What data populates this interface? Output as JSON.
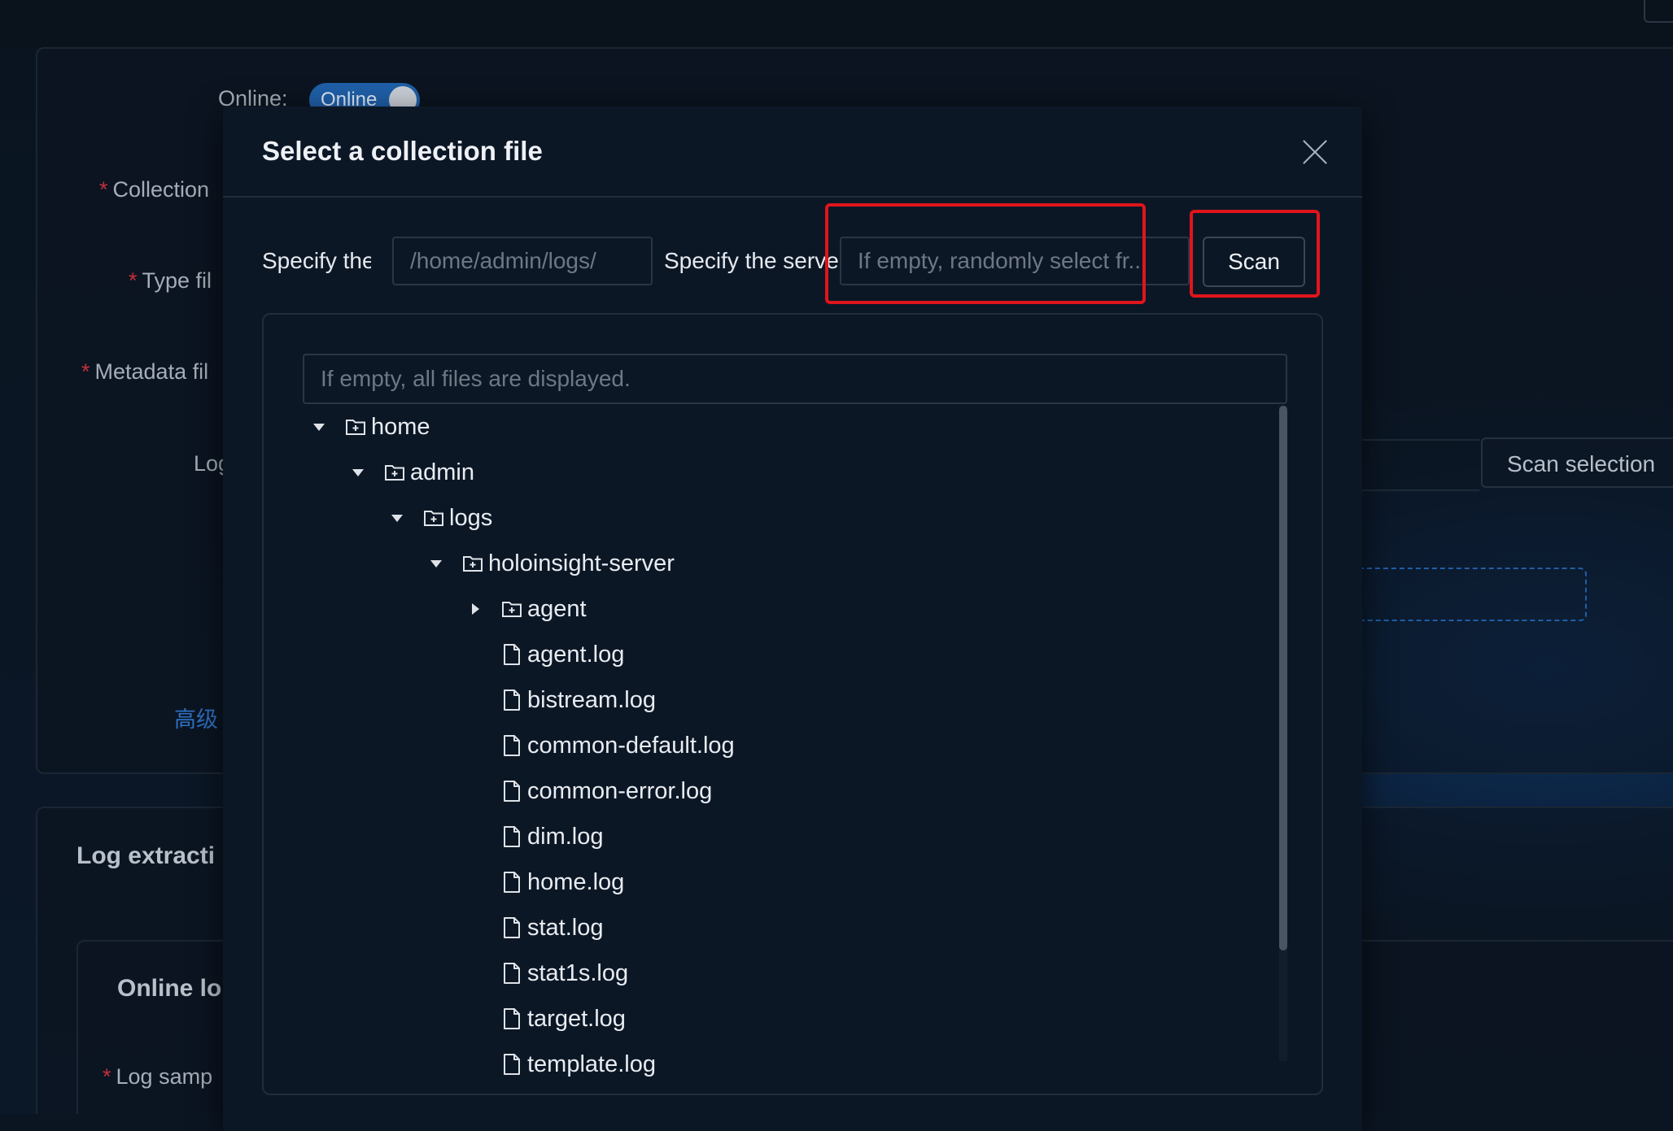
{
  "background": {
    "online_label": "Online:",
    "online_toggle_text": "Online",
    "collection_label": "Collection",
    "type_label": "Type fil",
    "metadata_label": "Metadata fil",
    "log_label": "Log",
    "advanced_link": "高级",
    "section_title": "Log extracti",
    "subsection_title": "Online lo",
    "log_sample_label": "Log samp",
    "scan_selection_button": "Scan selection"
  },
  "modal": {
    "title": "Select a collection file",
    "path_label": "Specify the r",
    "path_placeholder": "/home/admin/logs/",
    "server_label": "Specify the serve",
    "server_placeholder": "If empty, randomly select fr...",
    "scan_button": "Scan",
    "filter_placeholder": "If empty, all files are displayed."
  },
  "tree": [
    {
      "label": "home",
      "depth": 0,
      "type": "folder",
      "state": "expanded"
    },
    {
      "label": "admin",
      "depth": 1,
      "type": "folder",
      "state": "expanded"
    },
    {
      "label": "logs",
      "depth": 2,
      "type": "folder",
      "state": "expanded"
    },
    {
      "label": "holoinsight-server",
      "depth": 3,
      "type": "folder",
      "state": "expanded"
    },
    {
      "label": "agent",
      "depth": 4,
      "type": "folder",
      "state": "collapsed"
    },
    {
      "label": "agent.log",
      "depth": 4,
      "type": "file"
    },
    {
      "label": "bistream.log",
      "depth": 4,
      "type": "file"
    },
    {
      "label": "common-default.log",
      "depth": 4,
      "type": "file"
    },
    {
      "label": "common-error.log",
      "depth": 4,
      "type": "file"
    },
    {
      "label": "dim.log",
      "depth": 4,
      "type": "file"
    },
    {
      "label": "home.log",
      "depth": 4,
      "type": "file"
    },
    {
      "label": "stat.log",
      "depth": 4,
      "type": "file"
    },
    {
      "label": "stat1s.log",
      "depth": 4,
      "type": "file"
    },
    {
      "label": "target.log",
      "depth": 4,
      "type": "file"
    },
    {
      "label": "template.log",
      "depth": 4,
      "type": "file"
    }
  ],
  "colors": {
    "annotation": "#e0151b",
    "toggle": "#1f5fa8",
    "link": "#2f6fc2",
    "required": "#c3303a"
  }
}
